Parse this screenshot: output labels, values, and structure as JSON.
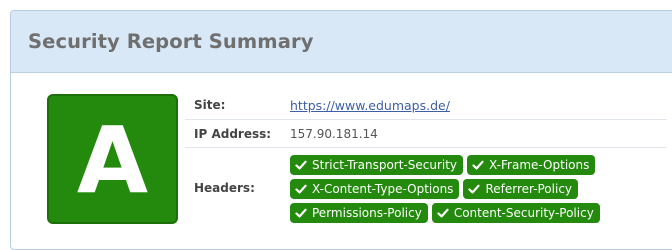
{
  "panel": {
    "title": "Security Report Summary"
  },
  "grade": {
    "letter": "A",
    "color": "#248a0d"
  },
  "rows": {
    "site": {
      "label": "Site:",
      "value": "https://www.edumaps.de/"
    },
    "ip": {
      "label": "IP Address:",
      "value": "157.90.181.14"
    },
    "headers": {
      "label": "Headers:",
      "badges": [
        "Strict-Transport-Security",
        "X-Frame-Options",
        "X-Content-Type-Options",
        "Referrer-Policy",
        "Permissions-Policy",
        "Content-Security-Policy"
      ],
      "badge_icon": "check-icon",
      "badge_color": "#248a0d"
    }
  }
}
